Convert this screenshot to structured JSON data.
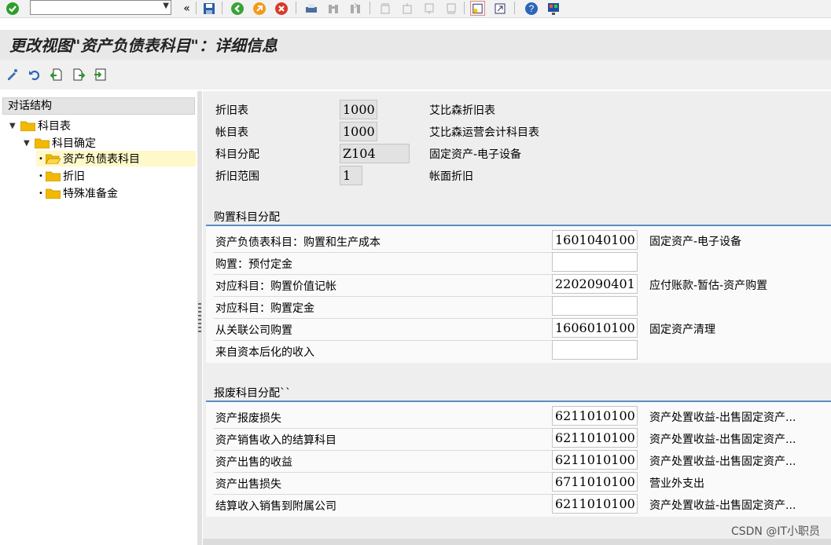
{
  "toolbar": {
    "icons": [
      "enter-icon",
      "command-field",
      "back-icon",
      "save-icon",
      "back-nav-icon",
      "exit-icon",
      "cancel-icon",
      "print-icon",
      "find-icon",
      "find-next-icon",
      "first-page-icon",
      "prev-page-icon",
      "next-page-icon",
      "last-page-icon",
      "new-session-icon",
      "shortcut-icon",
      "help-icon",
      "layout-icon"
    ],
    "command_value": ""
  },
  "title": "更改视图\"资产负债表科目\"：详细信息",
  "apptoolbar": {
    "icons": [
      "display-change-icon",
      "undo-icon",
      "prev-entry-icon",
      "next-entry-icon",
      "variant-icon"
    ]
  },
  "tree": {
    "header": "对话结构",
    "nodes": [
      {
        "label": "科目表",
        "level": 0,
        "expanded": true
      },
      {
        "label": "科目确定",
        "level": 1,
        "expanded": true
      },
      {
        "label": "资产负债表科目",
        "level": 2,
        "selected": true
      },
      {
        "label": "折旧",
        "level": 2
      },
      {
        "label": "特殊准备金",
        "level": 2
      }
    ]
  },
  "header_fields": [
    {
      "label": "折旧表",
      "value": "1000",
      "desc": "艾比森折旧表"
    },
    {
      "label": "帐目表",
      "value": "1000",
      "desc": "艾比森运营会计科目表"
    },
    {
      "label": "科目分配",
      "value": "Z104",
      "desc": "固定资产-电子设备"
    },
    {
      "label": "折旧范围",
      "value": "1",
      "desc": "帐面折旧"
    }
  ],
  "groups": [
    {
      "title": "购置科目分配",
      "rows": [
        {
          "label": "资产负债表科目：购置和生产成本",
          "value": "1601040100",
          "desc": "固定资产-电子设备"
        },
        {
          "label": "购置：预付定金",
          "value": "",
          "desc": ""
        },
        {
          "label": "对应科目：购置价值记帐",
          "value": "2202090401",
          "desc": "应付账款-暂估-资产购置"
        },
        {
          "label": "对应科目：购置定金",
          "value": "",
          "desc": ""
        },
        {
          "label": "从关联公司购置",
          "value": "1606010100",
          "desc": "固定资产清理"
        },
        {
          "label": "来自资本后化的收入",
          "value": "",
          "desc": ""
        }
      ]
    },
    {
      "title": "报废科目分配``",
      "rows": [
        {
          "label": "资产报废损失",
          "value": "6211010100",
          "desc": "资产处置收益-出售固定资产..."
        },
        {
          "label": "资产销售收入的结算科目",
          "value": "6211010100",
          "desc": "资产处置收益-出售固定资产..."
        },
        {
          "label": "资产出售的收益",
          "value": "6211010100",
          "desc": "资产处置收益-出售固定资产..."
        },
        {
          "label": "资产出售损失",
          "value": "6711010100",
          "desc": "营业外支出"
        },
        {
          "label": "结算收入销售到附属公司",
          "value": "6211010100",
          "desc": "资产处置收益-出售固定资产..."
        }
      ]
    }
  ],
  "watermark": "CSDN @IT小职员",
  "colors": {
    "accent_line": "#5a8ec2",
    "selected_bg": "#fff8c8",
    "folder": "#f3b900"
  }
}
